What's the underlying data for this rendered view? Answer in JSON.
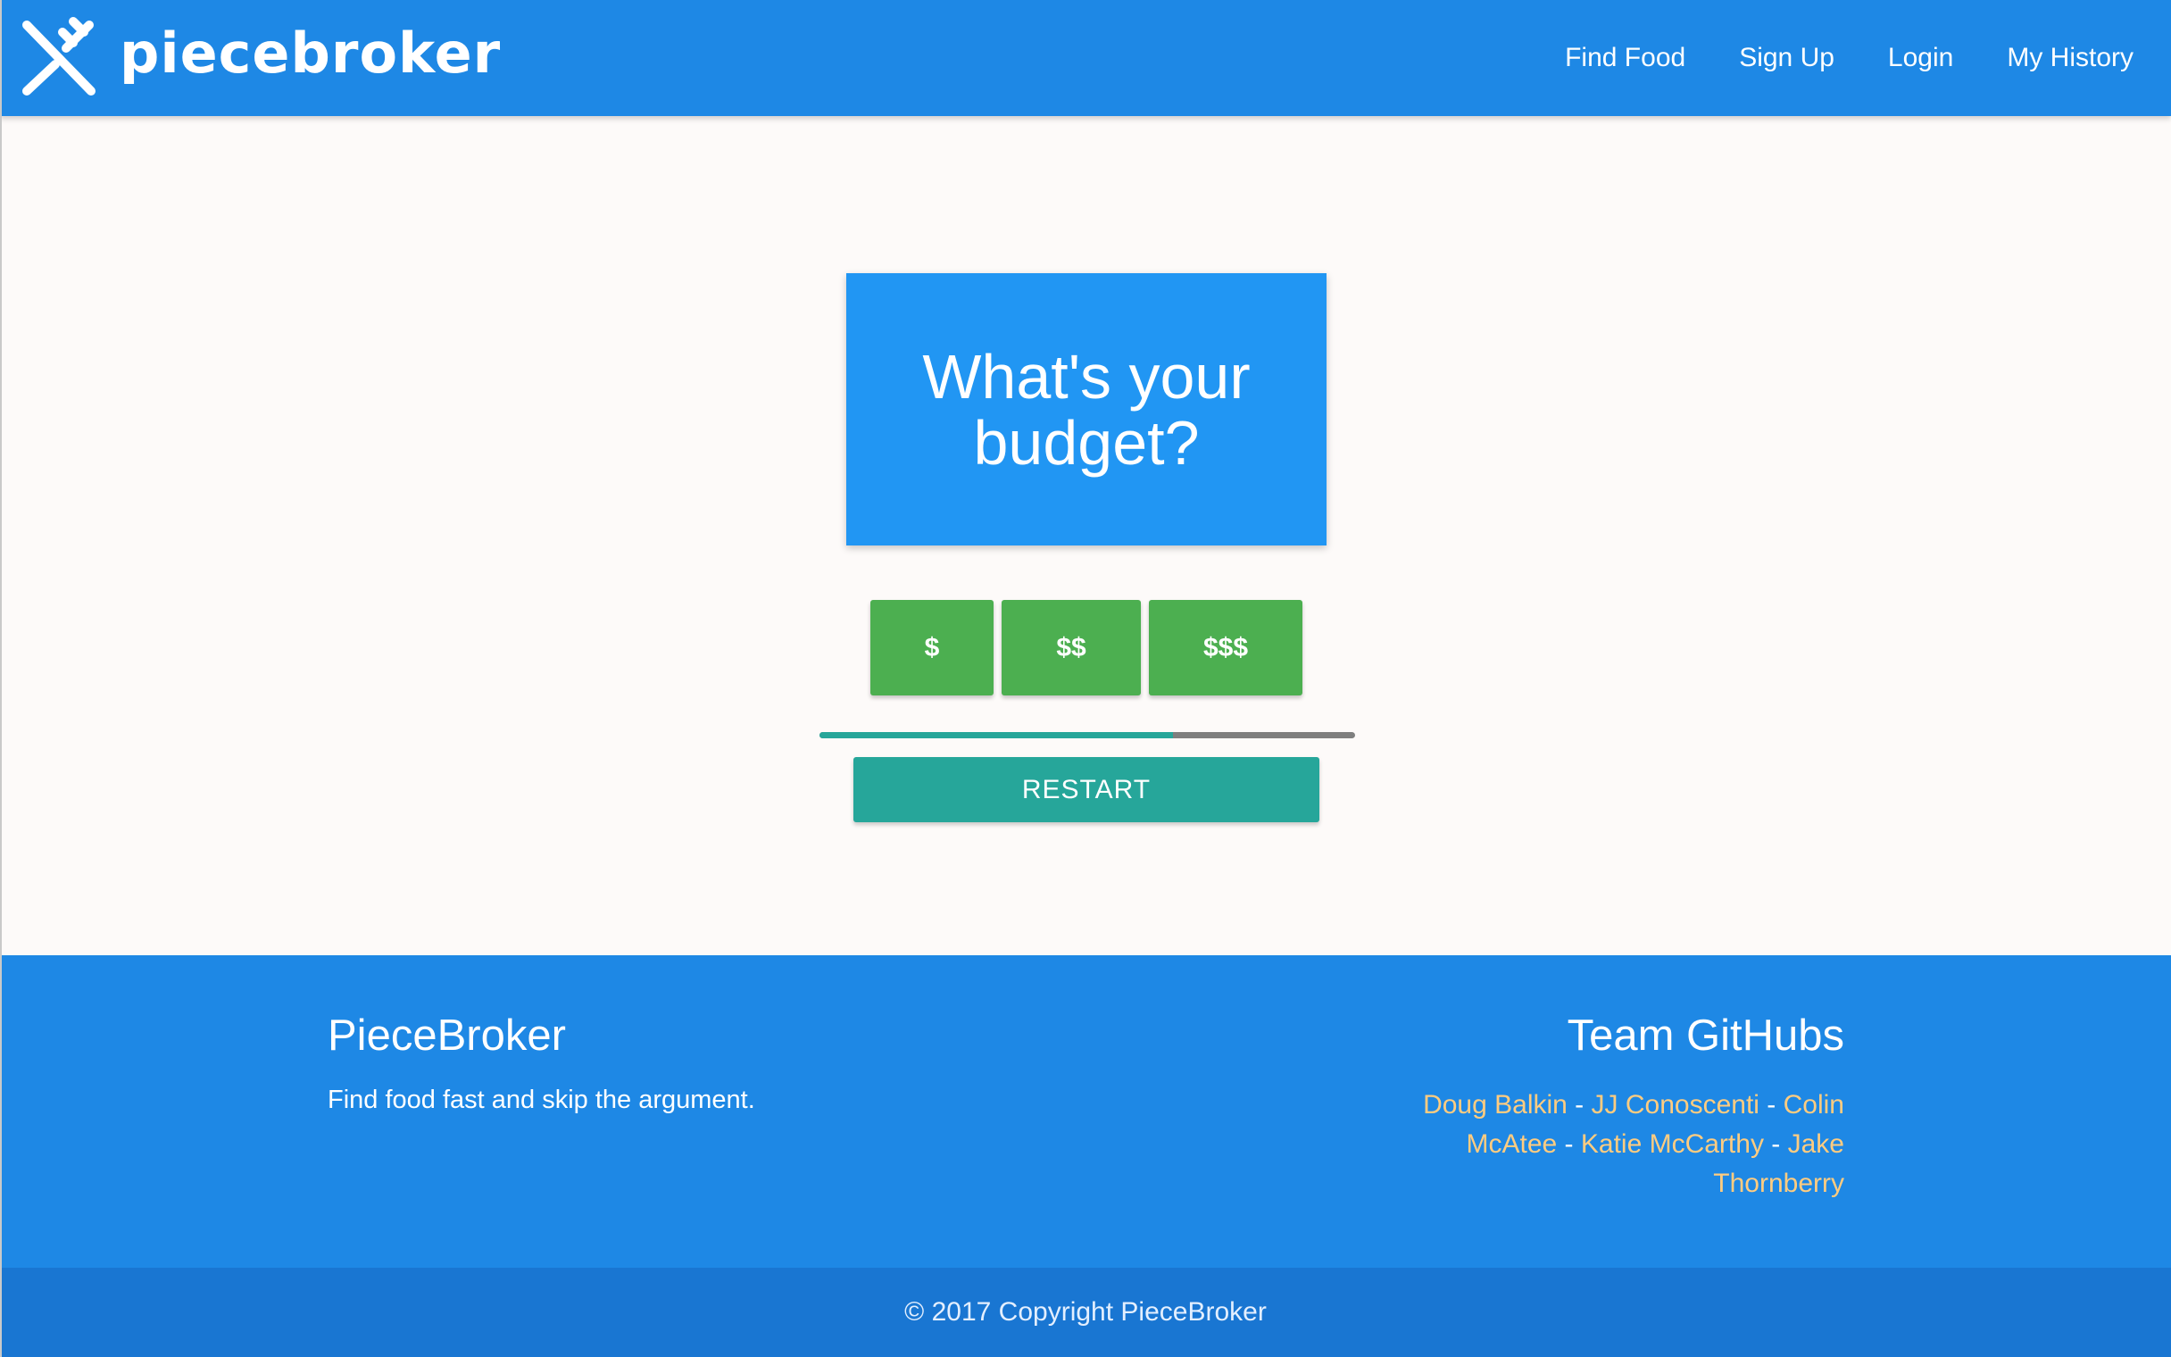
{
  "brand": {
    "name": "piecebroker",
    "logo_icon": "fork-knife-icon"
  },
  "nav": {
    "items": [
      {
        "label": "Find Food"
      },
      {
        "label": "Sign Up"
      },
      {
        "label": "Login"
      },
      {
        "label": "My History"
      }
    ]
  },
  "quiz": {
    "question": "What's your budget?",
    "options": [
      {
        "label": "$"
      },
      {
        "label": "$$"
      },
      {
        "label": "$$$"
      }
    ],
    "progress": 0.66,
    "restart_label": "RESTART"
  },
  "footer": {
    "title": "PieceBroker",
    "tagline": "Find food fast and skip the argument.",
    "team_title": "Team GitHubs",
    "team_members": [
      {
        "name": "Doug Balkin"
      },
      {
        "name": "JJ Conoscenti"
      },
      {
        "name": "Colin McAtee"
      },
      {
        "name": "Katie McCarthy"
      },
      {
        "name": "Jake Thornberry"
      }
    ],
    "separator": " - ",
    "copyright": "© 2017 Copyright PieceBroker"
  },
  "colors": {
    "nav_bg": "#1e88e5",
    "card_bg": "#2196f3",
    "option_bg": "#4caf50",
    "accent_teal": "#26a69a",
    "link_orange": "#ffcc80",
    "copyright_bg": "#1976d2"
  }
}
